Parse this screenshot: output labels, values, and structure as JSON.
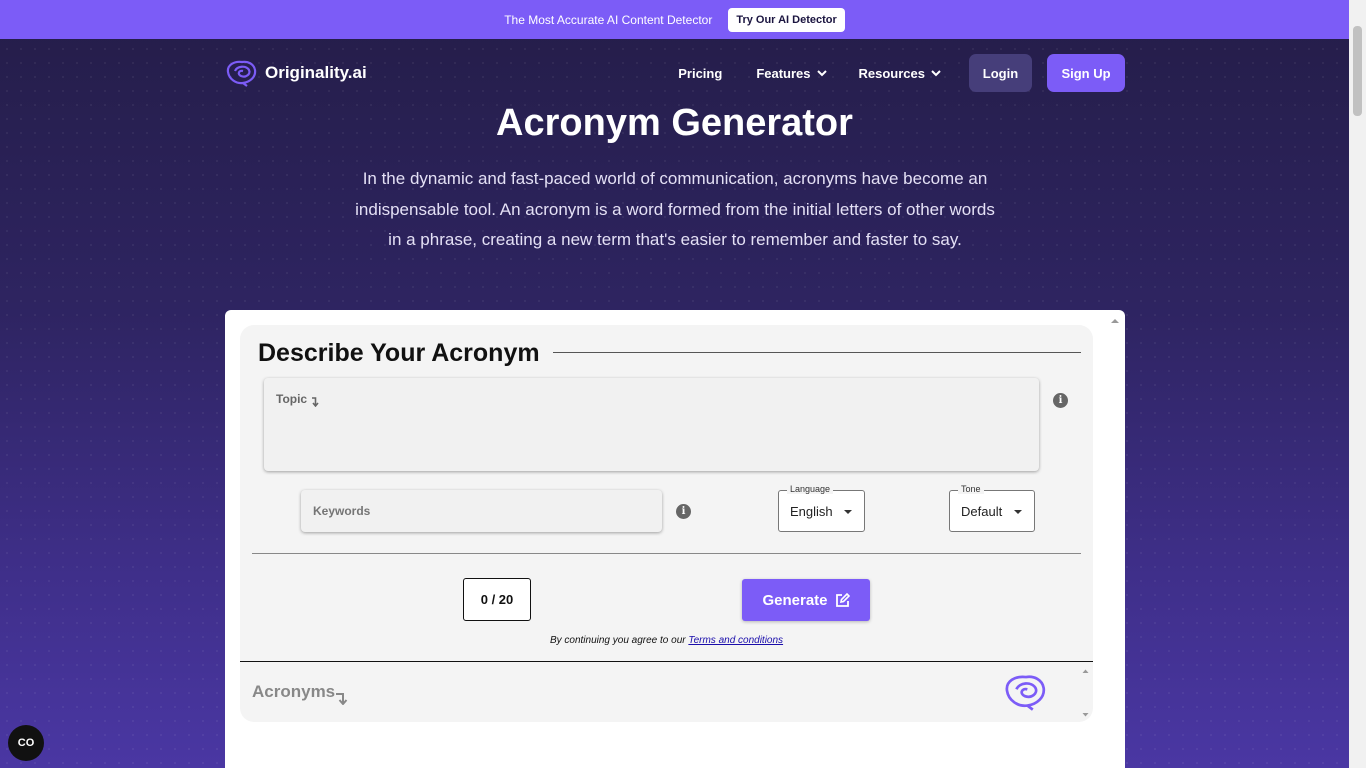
{
  "banner": {
    "text": "The Most Accurate AI Content Detector",
    "button_label": "Try Our AI Detector"
  },
  "nav": {
    "logo_text": "Originality.ai",
    "links": [
      {
        "label": "Pricing",
        "has_dropdown": false
      },
      {
        "label": "Features",
        "has_dropdown": true
      },
      {
        "label": "Resources",
        "has_dropdown": true
      }
    ],
    "login_label": "Login",
    "signup_label": "Sign Up"
  },
  "hero": {
    "title": "Acronym Generator",
    "description": "In the dynamic and fast-paced world of communication, acronyms have become an indispensable tool. An acronym is a word formed from the initial letters of other words in a phrase, creating a new term that's easier to remember and faster to say."
  },
  "form": {
    "section_title": "Describe Your Acronym",
    "topic_label": "Topic",
    "keywords_placeholder": "Keywords",
    "language": {
      "label": "Language",
      "value": "English"
    },
    "tone": {
      "label": "Tone",
      "value": "Default"
    },
    "counter": "0 / 20",
    "generate_label": "Generate",
    "agree_text": "By continuing you agree to our",
    "terms_link": "Terms and conditions",
    "results_title": "Acronyms"
  },
  "widgets": {
    "cookie_button": "CO"
  },
  "colors": {
    "accent": "#7c5cf7",
    "banner_bg": "#7c5cf7",
    "page_bg": "#2a1f55",
    "login_bg": "#463e7a"
  }
}
